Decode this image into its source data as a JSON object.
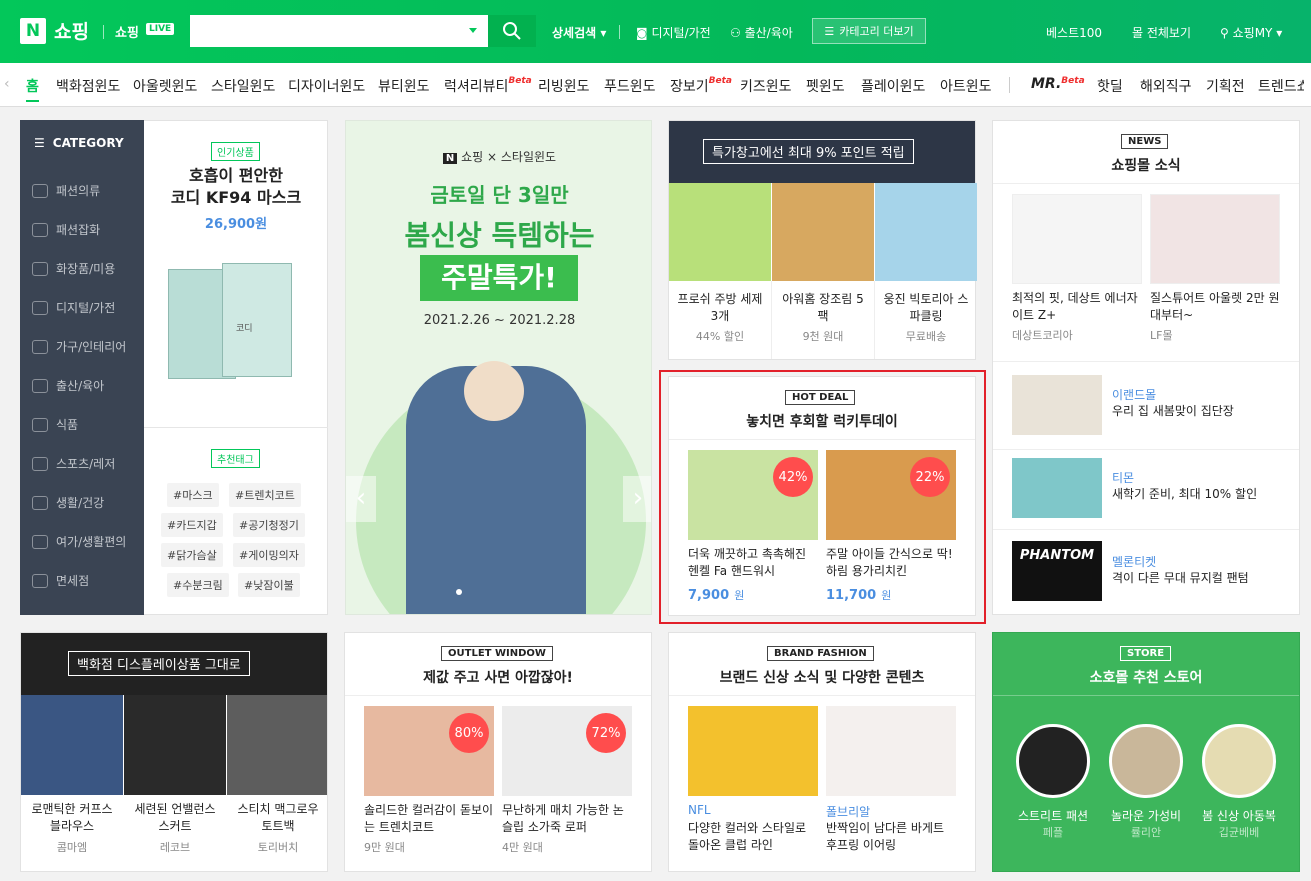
{
  "header": {
    "logo_n": "N",
    "logo_text": "쇼핑",
    "live_text": "쇼핑",
    "live_badge": "LIVE",
    "search_placeholder": "",
    "search_value": "",
    "detail_search": "상세검색",
    "links": [
      "디지털/가전",
      "출산/육아"
    ],
    "category_more": "카테고리 더보기",
    "right_links": [
      "베스트100",
      "몰 전체보기",
      "쇼핑MY"
    ]
  },
  "tabs": [
    "홈",
    "백화점윈도",
    "아울렛윈도",
    "스타일윈도",
    "디자이너윈도",
    "뷰티윈도",
    "럭셔리뷰티",
    "리빙윈도",
    "푸드윈도",
    "장보기",
    "키즈윈도",
    "펫윈도",
    "플레이윈도",
    "아트윈도",
    "MR.",
    "핫딜",
    "해외직구",
    "기획전",
    "트렌드쇼"
  ],
  "beta": "Beta",
  "category": {
    "title": "CATEGORY",
    "items": [
      "패션의류",
      "패션잡화",
      "화장품/미용",
      "디지털/가전",
      "가구/인테리어",
      "출산/육아",
      "식품",
      "스포츠/레저",
      "생활/건강",
      "여가/생활편의",
      "면세점"
    ]
  },
  "popular": {
    "badge": "인기상품",
    "title1": "호흡이 편안한",
    "title2": "코디 KF94 마스크",
    "price": "26,900원",
    "box_label": "코디"
  },
  "recommended_tags": {
    "badge": "추천태그",
    "tags": [
      "#마스크",
      "#트렌치코트",
      "#카드지갑",
      "#공기청정기",
      "#닭가슴살",
      "#게이밍의자",
      "#수분크림",
      "#낮잠이불"
    ]
  },
  "banner": {
    "brand": "쇼핑 × 스타일윈도",
    "line1": "금토일 단 3일만",
    "line2": "봄신상 득템하는",
    "line3": "주말특가!",
    "date": "2021.2.26 ~ 2021.2.28"
  },
  "warehouse": {
    "title": "특가창고에선 최대 9% 포인트 적립",
    "items": [
      {
        "name": "프로쉬 주방 세제 3개",
        "sub": "44% 할인"
      },
      {
        "name": "아워홈 장조림 5팩",
        "sub": "9천 원대"
      },
      {
        "name": "웅진 빅토리아 스파클링",
        "sub": "무료배송"
      }
    ]
  },
  "hotdeal": {
    "badge": "HOT DEAL",
    "title": "놓치면 후회할 럭키투데이",
    "items": [
      {
        "name": "더욱 깨끗하고 촉촉해진 헨켈 Fa 핸드워시",
        "price": "7,900",
        "unit": "원",
        "discount": "42%"
      },
      {
        "name": "주말 아이들 간식으로 딱! 하림 용가리치킨",
        "price": "11,700",
        "unit": "원",
        "discount": "22%"
      }
    ]
  },
  "news": {
    "badge": "NEWS",
    "title": "쇼핑몰 소식",
    "items": [
      {
        "name": "최적의 핏, 데상트 에너자이트 Z+",
        "sub": "데상트코리아"
      },
      {
        "name": "질스튜어트 아울렛 2만 원대부터~",
        "sub": "LF몰"
      }
    ],
    "list": [
      {
        "brand": "이랜드몰",
        "text": "우리 집 새봄맞이 집단장"
      },
      {
        "brand": "티몬",
        "text": "새학기 준비, 최대 10% 할인"
      },
      {
        "brand": "멜론티켓",
        "text": "격이 다른 무대 뮤지컬 팬텀",
        "poster": "PHANTOM"
      }
    ]
  },
  "department": {
    "title": "백화점 디스플레이상품 그대로",
    "items": [
      {
        "name": "로맨틱한 커프스 블라우스",
        "sub": "콤마엠"
      },
      {
        "name": "세련된 언밸런스 스커트",
        "sub": "레코브"
      },
      {
        "name": "스티치 맥그로우 토트백",
        "sub": "토리버치"
      }
    ]
  },
  "outlet": {
    "badge": "OUTLET WINDOW",
    "title": "제값 주고 사면 아깝잖아!",
    "items": [
      {
        "name": "솔리드한 컬러감이 돋보이는 트렌치코트",
        "sub": "9만 원대",
        "discount": "80%"
      },
      {
        "name": "무난하게 매치 가능한 논슬립 소가죽 로퍼",
        "sub": "4만 원대",
        "discount": "72%"
      }
    ]
  },
  "brand": {
    "badge": "BRAND FASHION",
    "title": "브랜드 신상 소식 및 다양한 콘텐츠",
    "items": [
      {
        "brand": "NFL",
        "name": "다양한 컬러와 스타일로 돌아온 클럽 라인"
      },
      {
        "brand": "폴브리알",
        "name": "반짝임이 남다른 바게트 후프링 이어링"
      }
    ]
  },
  "store": {
    "badge": "STORE",
    "title": "소호몰 추천 스토어",
    "items": [
      {
        "name": "스트리트 패션",
        "sub": "페플"
      },
      {
        "name": "놀라운 가성비",
        "sub": "률리안"
      },
      {
        "name": "봄 신상 아동복",
        "sub": "깁균베베"
      }
    ]
  },
  "colors": {
    "brand": "#03c75a",
    "category_bg": "#3a4453",
    "price": "#4a8ee0",
    "discount": "#ff4d4d",
    "hotdeal_border": "#e2202a",
    "store_bg": "#3db65c"
  }
}
